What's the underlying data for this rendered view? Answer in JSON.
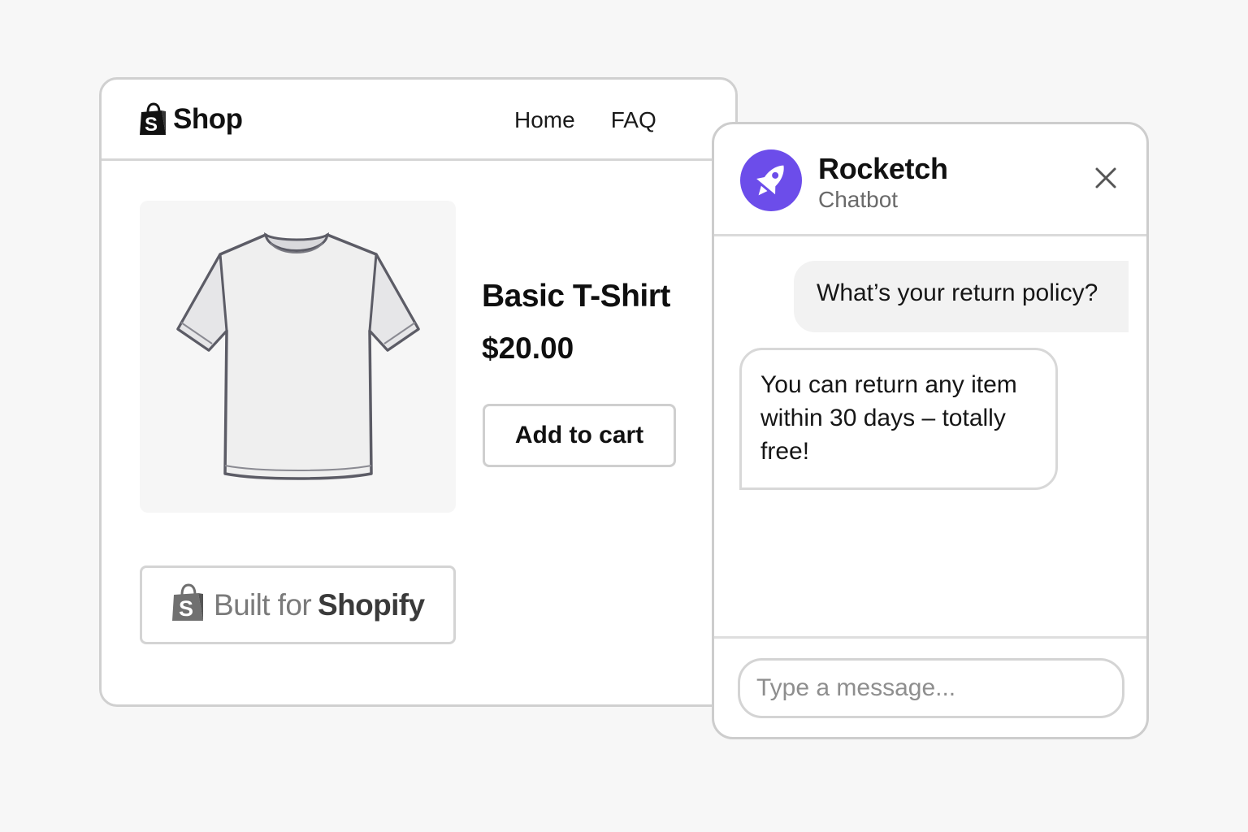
{
  "shop": {
    "title": "Shop",
    "nav": {
      "home": "Home",
      "faq": "FAQ"
    },
    "product": {
      "name": "Basic T-Shirt",
      "price": "$20.00",
      "add_to_cart_label": "Add to cart",
      "image_icon": "t-shirt-icon"
    },
    "badge": {
      "light_text": "Built for",
      "strong_text": "Shopify",
      "icon": "shopify-bag-icon"
    }
  },
  "chat": {
    "bot_name": "Rocketch",
    "bot_subtitle": "Chatbot",
    "avatar_icon": "rocket-icon",
    "avatar_color": "#6c4dea",
    "close_icon": "close-icon",
    "messages": [
      {
        "sender": "user",
        "text": "What’s your return policy?"
      },
      {
        "sender": "bot",
        "text": "You can return any item within 30 days – totally free!"
      }
    ],
    "input_placeholder": "Type a message..."
  }
}
